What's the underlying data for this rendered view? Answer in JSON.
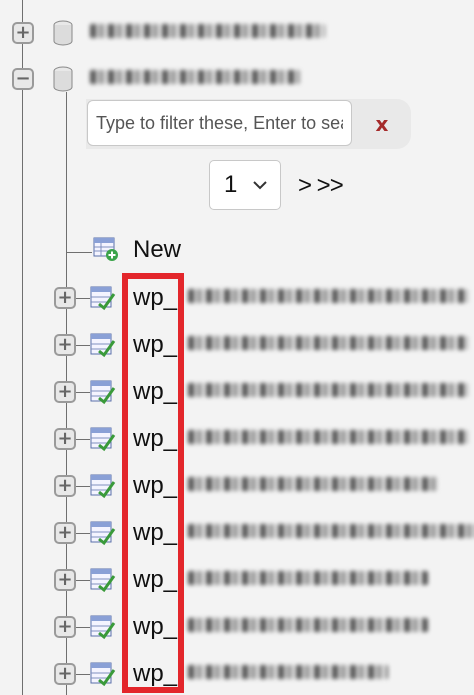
{
  "tree": {
    "databases": [
      {
        "expander": "+",
        "state": "collapsed"
      },
      {
        "expander": "−",
        "state": "expanded"
      }
    ],
    "filter": {
      "placeholder": "Type to filter these, Enter to search all",
      "clear_label": "x"
    },
    "pagination": {
      "page_value": "1",
      "next_label": "> >>"
    },
    "new_label": "New",
    "tables": [
      {
        "prefix": "wp_",
        "expander": "+"
      },
      {
        "prefix": "wp_",
        "expander": "+"
      },
      {
        "prefix": "wp_",
        "expander": "+"
      },
      {
        "prefix": "wp_",
        "expander": "+"
      },
      {
        "prefix": "wp_",
        "expander": "+"
      },
      {
        "prefix": "wp_",
        "expander": "+"
      },
      {
        "prefix": "wp_",
        "expander": "+"
      },
      {
        "prefix": "wp_",
        "expander": "+"
      },
      {
        "prefix": "wp_",
        "expander": "+"
      }
    ]
  },
  "colors": {
    "highlight": "#e3262b",
    "clear_x": "#a52a2a",
    "background": "#f3f3f3"
  },
  "icons": [
    "expand-icon",
    "collapse-icon",
    "database-icon",
    "new-table-icon",
    "table-icon",
    "chevron-down-icon"
  ]
}
